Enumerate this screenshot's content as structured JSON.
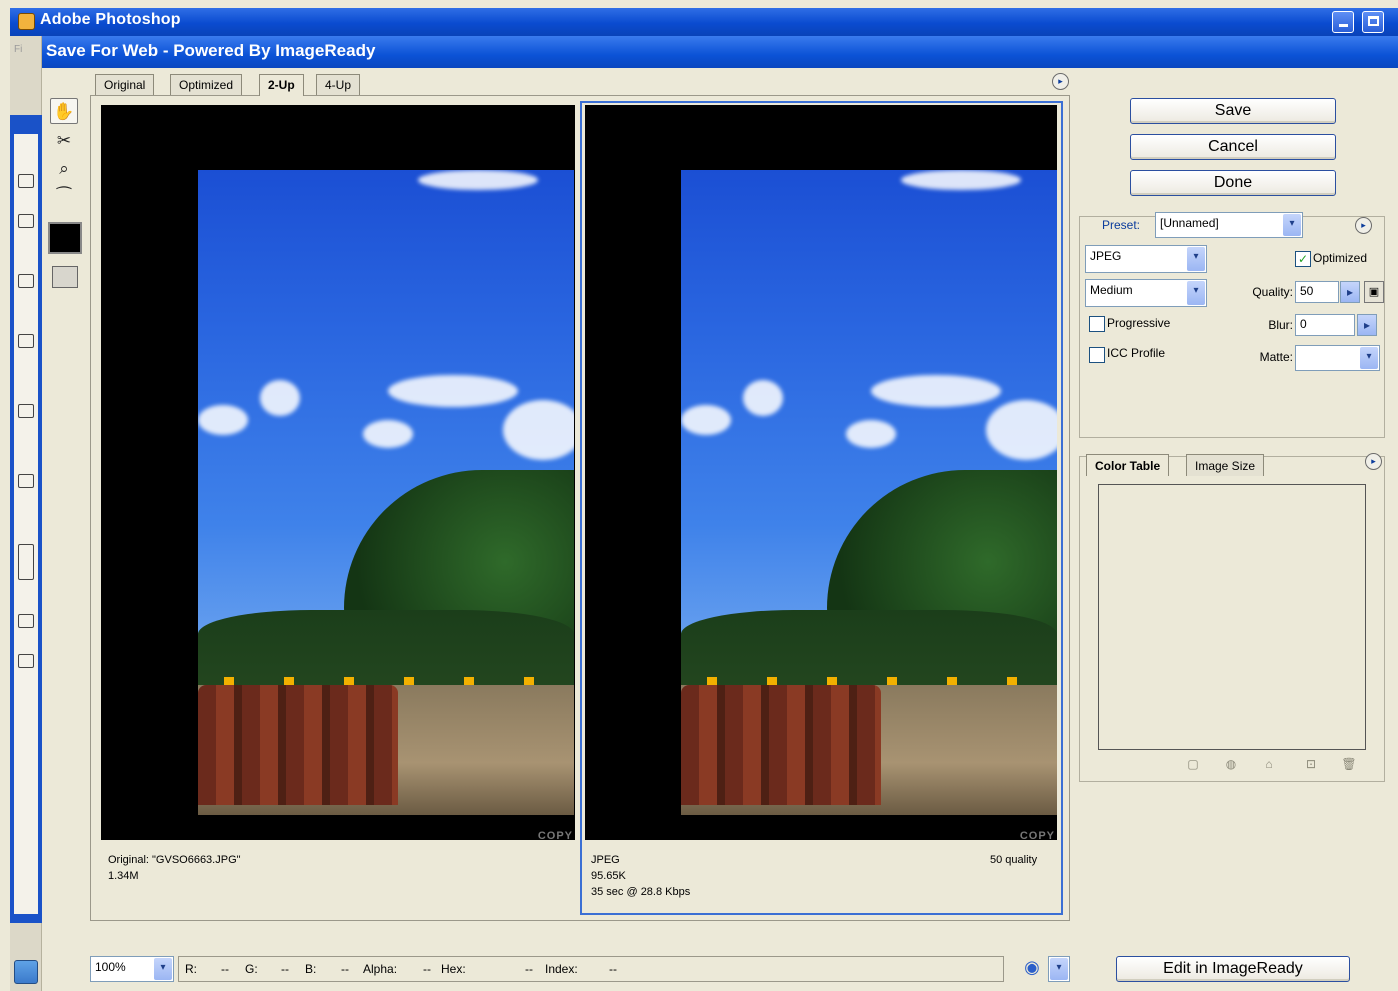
{
  "app": {
    "title": "Adobe Photoshop"
  },
  "dialog": {
    "title": "Save For Web - Powered By ImageReady",
    "menu_ghost": "Fi"
  },
  "tabs": [
    {
      "label": "Original"
    },
    {
      "label": "Optimized"
    },
    {
      "label": "2-Up"
    },
    {
      "label": "4-Up"
    }
  ],
  "original_pane": {
    "info_line1": "Original: \"GVSO6663.JPG\"",
    "info_line2": "1.34M",
    "watermark": "COPY"
  },
  "optimized_pane": {
    "info_line1": "JPEG",
    "info_line2": "95.65K",
    "info_line3": "35 sec @ 28.8 Kbps",
    "quality_text": "50 quality",
    "watermark": "COPY"
  },
  "buttons": {
    "save": "Save",
    "cancel": "Cancel",
    "done": "Done",
    "edit_imageready": "Edit in ImageReady"
  },
  "settings": {
    "preset_label": "Preset:",
    "preset_value": "[Unnamed]",
    "format": "JPEG",
    "compression": "Medium",
    "optimized_label": "Optimized",
    "optimized_checked": true,
    "progressive_label": "Progressive",
    "progressive_checked": false,
    "icc_label": "ICC Profile",
    "icc_checked": false,
    "quality_label": "Quality:",
    "quality_value": "50",
    "blur_label": "Blur:",
    "blur_value": "0",
    "matte_label": "Matte:",
    "matte_value": ""
  },
  "panel_tabs": {
    "color_table": "Color Table",
    "image_size": "Image Size"
  },
  "status": {
    "zoom": "100%",
    "r_label": "R:",
    "r_value": "--",
    "g_label": "G:",
    "g_value": "--",
    "b_label": "B:",
    "b_value": "--",
    "alpha_label": "Alpha:",
    "alpha_value": "--",
    "hex_label": "Hex:",
    "hex_value": "--",
    "index_label": "Index:",
    "index_value": "--"
  },
  "icons": {
    "menu": "▸",
    "dropdown": "▾",
    "step": "▸",
    "check": "✓",
    "hand": "✋",
    "zoom": "⌕",
    "eyedropper": "⁀",
    "slice": "✂",
    "browser": "◉"
  },
  "colors": {
    "title_blue": "#0b52d6",
    "accent_border": "#3b6fd4"
  }
}
